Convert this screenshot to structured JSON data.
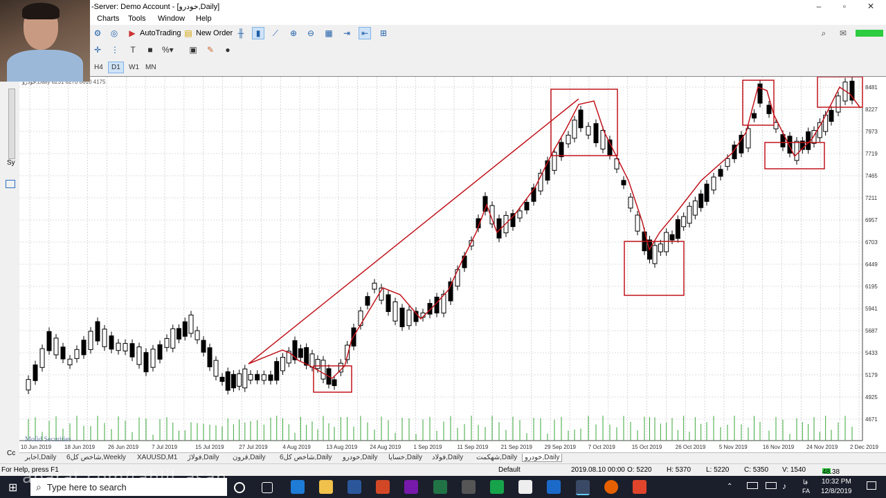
{
  "window": {
    "title": "-Server: Demo Account - [خودرو,Daily]"
  },
  "menu": {
    "items": [
      "Charts",
      "Tools",
      "Window",
      "Help"
    ]
  },
  "toolbar": {
    "autotrading": "AutoTrading",
    "new_order": "New Order"
  },
  "timeframes": [
    "H4",
    "D1",
    "W1",
    "MN"
  ],
  "timeframe_selected": "D1",
  "chart": {
    "info": "خودرو,Daily  8231 8270 8610  4175",
    "price_labels": [
      "8481",
      "8227",
      "7973",
      "7719",
      "7465",
      "7211",
      "6957",
      "6703",
      "6449",
      "6195",
      "5941",
      "5687",
      "5433",
      "5179",
      "4925",
      "4671"
    ],
    "date_labels": [
      "10 Jun 2019",
      "18 Jun 2019",
      "26 Jun 2019",
      "7 Jul 2019",
      "15 Jul 2019",
      "27 Jul 2019",
      "4 Aug 2019",
      "13 Aug 2019",
      "24 Aug 2019",
      "1 Sep 2019",
      "11 Sep 2019",
      "21 Sep 2019",
      "29 Sep 2019",
      "7 Oct 2019",
      "15 Oct 2019",
      "26 Oct 2019",
      "5 Nov 2019",
      "16 Nov 2019",
      "24 Nov 2019",
      "2 Dec 2019"
    ],
    "broker_label": "Mofid Securities"
  },
  "tabs": [
    "اخابر,Daily",
    "شاخص کل6,Weekly",
    "XAUUSD,M1",
    "فولاژ,Daily",
    "قرون,Daily",
    "شاخص کل6,Daily",
    "خودرو,Daily",
    "خسایا,Daily",
    "فولاد,Daily",
    "شهکمت,Daily",
    "خودرو,Daily"
  ],
  "active_tab_index": 10,
  "status": {
    "help": "For Help, press F1",
    "profile": "Default",
    "datetime": "2019.08.10 00:00",
    "open": "O: 5220",
    "high": "H: 5370",
    "low": "L: 5220",
    "close": "C: 5350",
    "volume": "V: 1540",
    "ping": "48.38 ms"
  },
  "taskbar": {
    "search_placeholder": "Type here to search",
    "time": "10:32 PM",
    "date": "12/8/2019",
    "lang": "FA"
  },
  "watermark": "aparat.com/tahlil_asan"
}
